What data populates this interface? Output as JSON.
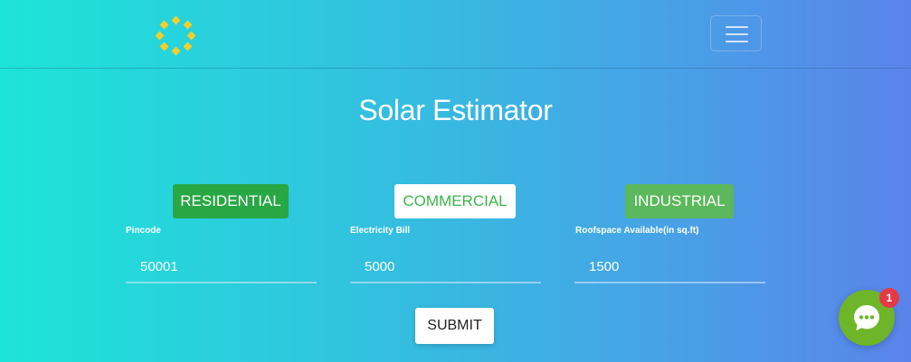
{
  "header": {
    "logo_icon": "sun-logo-icon",
    "menu_icon": "hamburger-menu-icon"
  },
  "page": {
    "title": "Solar Estimator"
  },
  "categories": {
    "residential": "RESIDENTIAL",
    "commercial": "COMMERCIAL",
    "industrial": "INDUSTRIAL"
  },
  "fields": {
    "pincode": {
      "label": "Pincode",
      "value": "50001"
    },
    "electricity_bill": {
      "label": "Electricity Bill",
      "value": "5000"
    },
    "roofspace": {
      "label": "Roofspace Available(in sq.ft)",
      "value": "1500"
    }
  },
  "actions": {
    "submit_label": "SUBMIT"
  },
  "chat": {
    "icon": "chat-bubble-icon",
    "unread_count": "1"
  },
  "colors": {
    "gradient_start": "#1de4d8",
    "gradient_end": "#5b83ea",
    "residential": "#28a745",
    "industrial": "#5cb85c",
    "chat": "#6eb52a",
    "badge": "#e53945",
    "logo": "#f2cf2a"
  }
}
